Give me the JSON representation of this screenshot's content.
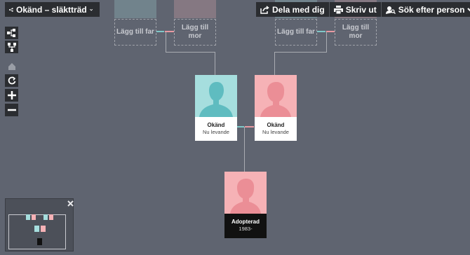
{
  "header": {
    "tree_title": "Okänd – släktträd",
    "share_label": "Dela med dig",
    "print_label": "Skriv ut",
    "search_label": "Sök efter person"
  },
  "placeholders": {
    "add_father": "Lägg till far",
    "add_mother_line1": "Lägg till",
    "add_mother_line2": "mor"
  },
  "persons": {
    "father": {
      "name": "Okänd",
      "status": "Nu levande"
    },
    "mother": {
      "name": "Okänd",
      "status": "Nu levande"
    },
    "child": {
      "name": "Adopterad",
      "years": "1983-"
    }
  },
  "colors": {
    "male": "#a6dede",
    "female": "#f6b2b6",
    "male_silhouette": "#5fbcc0",
    "female_silhouette": "#eb8e96",
    "background": "#5f6470"
  }
}
